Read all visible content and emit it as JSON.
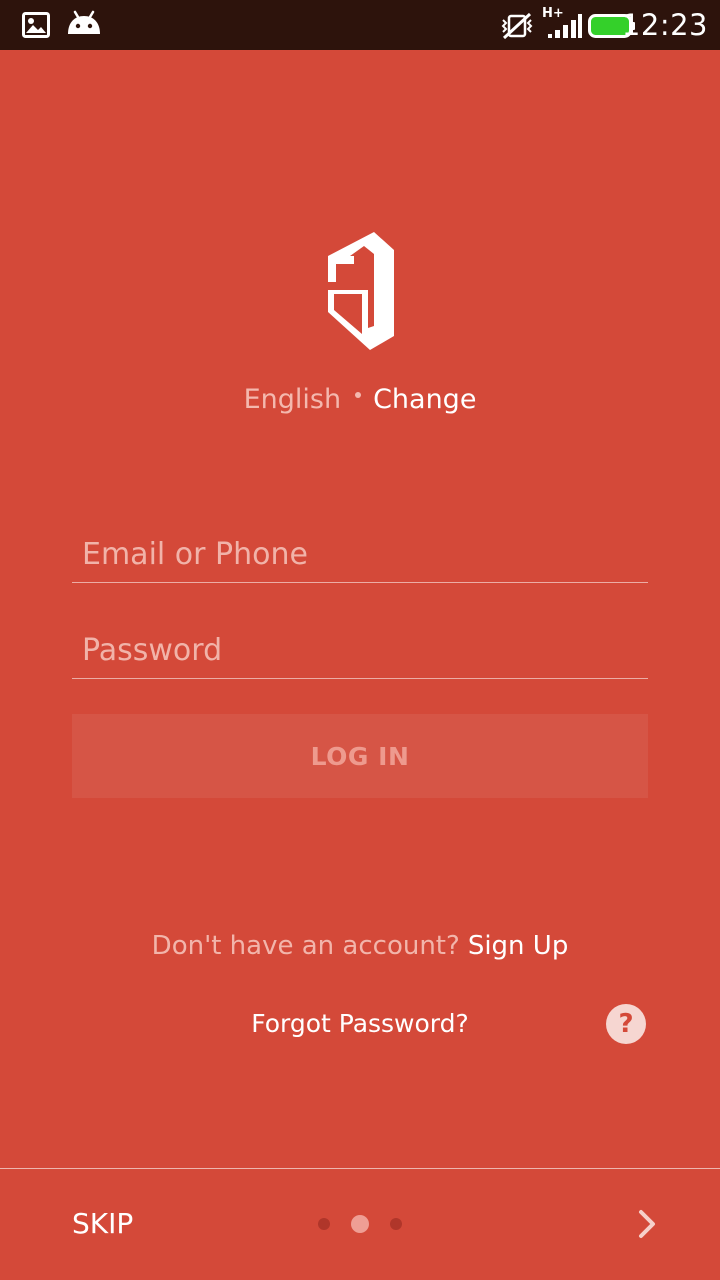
{
  "status_bar": {
    "time": "12:23",
    "network": "H+",
    "icons": [
      "image-icon",
      "android-icon",
      "vibrate-mute-icon",
      "signal-icon",
      "battery-icon"
    ]
  },
  "brand": {
    "logo": "app-logo",
    "background_color": "#d44939"
  },
  "language": {
    "current": "English",
    "change_label": "Change"
  },
  "form": {
    "email_placeholder": "Email or Phone",
    "password_placeholder": "Password",
    "login_label": "LOG IN"
  },
  "signup": {
    "prompt": "Don't have an account?",
    "link": "Sign Up"
  },
  "forgot_password": "Forgot Password?",
  "help_symbol": "?",
  "footer": {
    "skip_label": "SKIP",
    "page_count": 3,
    "active_page": 2
  }
}
